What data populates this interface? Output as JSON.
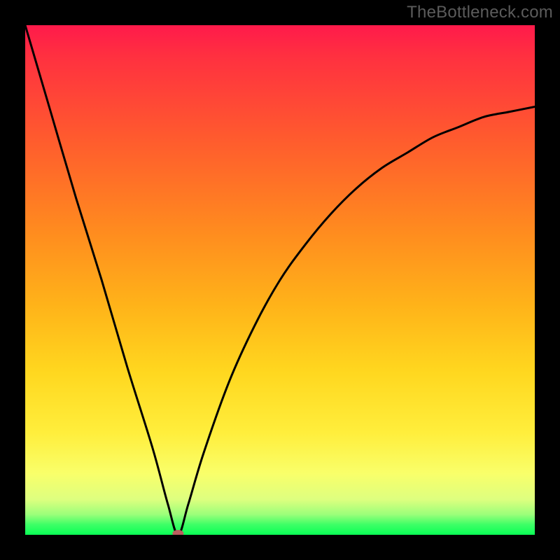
{
  "watermark": "TheBottleneck.com",
  "colors": {
    "frame": "#000000",
    "gradient_top": "#ff1a4b",
    "gradient_bottom": "#0aff56",
    "curve": "#000000",
    "marker": "#bb5d5f"
  },
  "chart_data": {
    "type": "line",
    "title": "",
    "xlabel": "",
    "ylabel": "",
    "xlim": [
      0,
      100
    ],
    "ylim": [
      0,
      100
    ],
    "description": "Bottleneck percentage curve minimized near x≈30. Left branch is a steep near-linear descent from top-left to the minimum; right branch rises with decreasing slope toward the upper-right.",
    "series": [
      {
        "name": "bottleneck-curve",
        "x": [
          0,
          5,
          10,
          15,
          20,
          25,
          28,
          30,
          32,
          35,
          40,
          45,
          50,
          55,
          60,
          65,
          70,
          75,
          80,
          85,
          90,
          95,
          100
        ],
        "y": [
          100,
          83,
          66,
          50,
          33,
          17,
          6,
          0,
          6,
          16,
          30,
          41,
          50,
          57,
          63,
          68,
          72,
          75,
          78,
          80,
          82,
          83,
          84
        ]
      }
    ],
    "minimum_marker": {
      "x": 30,
      "y": 0
    }
  }
}
